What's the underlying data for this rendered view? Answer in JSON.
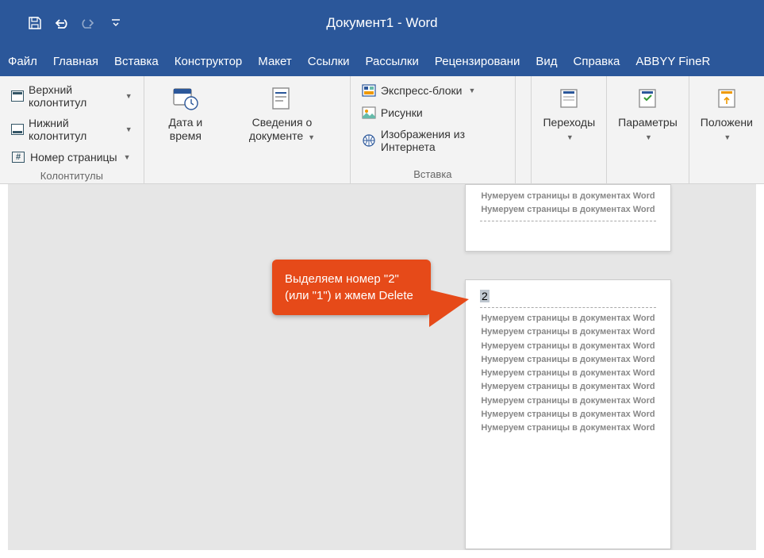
{
  "title": "Документ1  -  Word",
  "tabs": [
    "Файл",
    "Главная",
    "Вставка",
    "Конструктор",
    "Макет",
    "Ссылки",
    "Рассылки",
    "Рецензировани",
    "Вид",
    "Справка",
    "ABBYY FineR"
  ],
  "ribbon": {
    "group1": {
      "label": "Колонтитулы",
      "top": "Верхний колонтитул",
      "bottom": "Нижний колонтитул",
      "page": "Номер страницы"
    },
    "group2": {
      "datetime": "Дата и время",
      "docinfo": "Сведения о документе"
    },
    "group3": {
      "label": "Вставка",
      "quick": "Экспресс-блоки",
      "pics": "Рисунки",
      "webpics": "Изображения из Интернета"
    },
    "group4": {
      "nav": "Переходы"
    },
    "group5": {
      "opts": "Параметры"
    },
    "group6": {
      "pos": "Положени"
    }
  },
  "callout": "Выделяем номер \"2\" (или \"1\") и жмем Delete",
  "pagenum": "2",
  "repeat_line": "Нумеруем страницы в документах Word"
}
